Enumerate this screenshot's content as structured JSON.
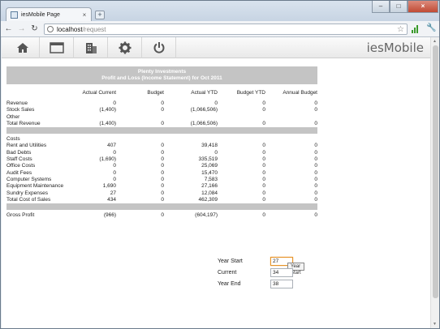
{
  "browser": {
    "tab_title": "iesMobile Page",
    "tab_close": "×",
    "new_tab": "+",
    "window_controls": [
      "–",
      "□",
      "×"
    ],
    "url_host": "localhost",
    "url_path": "/request",
    "icons": [
      "back-arrow-icon",
      "forward-arrow-icon",
      "reload-icon",
      "page-icon",
      "star-icon",
      "signal-icon",
      "wrench-icon"
    ]
  },
  "app": {
    "brand": "iesMobile",
    "toolbar_icons": [
      "home-icon",
      "window-icon",
      "building-icon",
      "gear-icon",
      "power-icon"
    ]
  },
  "report": {
    "company": "Plenty Investments",
    "subtitle": "Profit and Loss (Income Statement) for Oct 2011",
    "columns": [
      "",
      "Actual Current",
      "Budget",
      "Actual YTD",
      "Budget YTD",
      "Annual Budget"
    ],
    "revenue_rows": [
      [
        "Revenue",
        "0",
        "0",
        "0",
        "0",
        "0"
      ],
      [
        "Stock Sales",
        "(1,400)",
        "0",
        "(1,066,506)",
        "0",
        "0"
      ],
      [
        "Other",
        "",
        "",
        "",
        "",
        ""
      ],
      [
        "Total Revenue",
        "(1,400)",
        "0",
        "(1,066,506)",
        "0",
        "0"
      ]
    ],
    "cost_rows": [
      [
        "Costs",
        "",
        "",
        "",
        "",
        ""
      ],
      [
        "Rent and Utilities",
        "407",
        "0",
        "39,418",
        "0",
        "0"
      ],
      [
        "Bad Debts",
        "0",
        "0",
        "0",
        "0",
        "0"
      ],
      [
        "Staff Costs",
        "(1,690)",
        "0",
        "335,519",
        "0",
        "0"
      ],
      [
        "Office Costs",
        "0",
        "0",
        "25,069",
        "0",
        "0"
      ],
      [
        "Audit Fees",
        "0",
        "0",
        "15,470",
        "0",
        "0"
      ],
      [
        "Computer Systems",
        "0",
        "0",
        "7,583",
        "0",
        "0"
      ],
      [
        "Equipment Maintenance",
        "1,690",
        "0",
        "27,166",
        "0",
        "0"
      ],
      [
        "Sundry Expenses",
        "27",
        "0",
        "12,084",
        "0",
        "0"
      ],
      [
        "Total Cost of Sales",
        "434",
        "0",
        "462,309",
        "0",
        "0"
      ]
    ],
    "profit_rows": [
      [
        "Gross Profit",
        "(966)",
        "0",
        "(604,197)",
        "0",
        "0"
      ]
    ]
  },
  "params": {
    "year_start_label": "Year Start",
    "year_start_value": "27",
    "year_start_tooltip": "Year Start",
    "current_label": "Current",
    "current_value": "34",
    "year_end_label": "Year End",
    "year_end_value": "38"
  }
}
